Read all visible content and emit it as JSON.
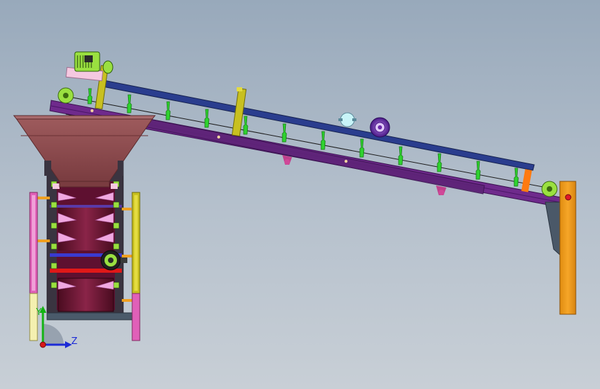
{
  "viewport": {
    "background_top": "#98a9bb",
    "background_bottom": "#c8cfd6"
  },
  "triad": {
    "y_label": "Y",
    "z_label": "Z",
    "y_color": "#12b312",
    "z_color": "#1c2bd6",
    "origin_color": "#d81818"
  },
  "colors": {
    "belt_rail": "#2a3d8e",
    "frame_beam": "#6f2a8c",
    "hopper": "#8a4a4e",
    "support_leg": "#f0a020",
    "cleats": "#2fd12f",
    "yellow_post": "#c8c020",
    "motor": "#9ae040",
    "pink_pad": "#f5c8e0",
    "drum": "#7a1c3c",
    "red_bar": "#e01818",
    "cyan_gauge": "#c8f4f8",
    "purple_pulley": "#6a28a8"
  },
  "icons": {
    "motor": "electric-motor-icon",
    "pulley": "pulley-icon",
    "gauge": "gauge-icon",
    "roller": "roller-icon"
  }
}
